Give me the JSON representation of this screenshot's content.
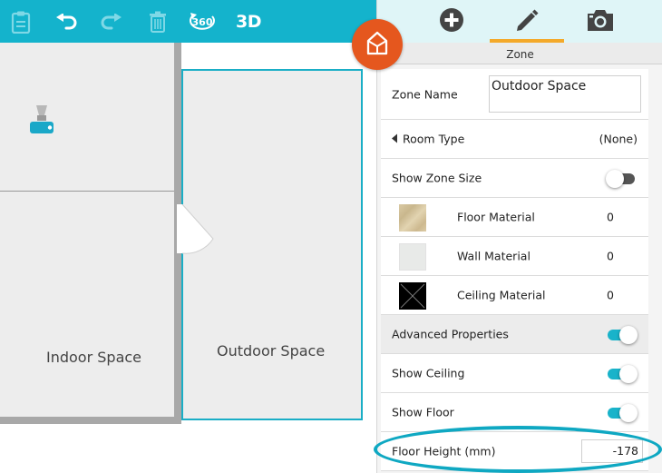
{
  "toolbar": {
    "buttons": [
      {
        "name": "clipboard-icon",
        "enabled": false
      },
      {
        "name": "undo-icon",
        "enabled": true
      },
      {
        "name": "redo-icon",
        "enabled": false
      },
      {
        "name": "trash-icon",
        "enabled": false
      },
      {
        "name": "view-360-icon",
        "label": "360",
        "enabled": true
      },
      {
        "name": "view-3d-button",
        "label": "3D",
        "enabled": true
      }
    ]
  },
  "canvas": {
    "rooms": [
      {
        "label": "Indoor Space",
        "selected": false
      },
      {
        "label": "Outdoor Space",
        "selected": true
      }
    ],
    "device_icon": "security-camera-icon",
    "fab_icon": "zone-house-icon"
  },
  "panel": {
    "tabs": [
      {
        "name": "add-icon",
        "active": false
      },
      {
        "name": "pencil-icon",
        "active": true
      },
      {
        "name": "camera-icon",
        "active": false
      }
    ],
    "header": "Zone",
    "zone_name_label": "Zone Name",
    "zone_name_value": "Outdoor Space",
    "room_type_label": "Room Type",
    "room_type_value": "(None)",
    "show_zone_size_label": "Show Zone Size",
    "show_zone_size_on": false,
    "materials": [
      {
        "label": "Floor Material",
        "value": "0",
        "swatch": "wood"
      },
      {
        "label": "Wall Material",
        "value": "0",
        "swatch": "plain"
      },
      {
        "label": "Ceiling Material",
        "value": "0",
        "swatch": "none"
      }
    ],
    "advanced_label": "Advanced Properties",
    "advanced_on": true,
    "show_ceiling_label": "Show Ceiling",
    "show_ceiling_on": true,
    "show_floor_label": "Show Floor",
    "show_floor_on": true,
    "floor_height_label": "Floor Height (mm)",
    "floor_height_value": "-178"
  },
  "colors": {
    "toolbar": "#14b3cc",
    "accent": "#19b3ca",
    "fab": "#e5571e",
    "active_tab_underline": "#f4a92a",
    "highlight": "#0fa8c2"
  }
}
